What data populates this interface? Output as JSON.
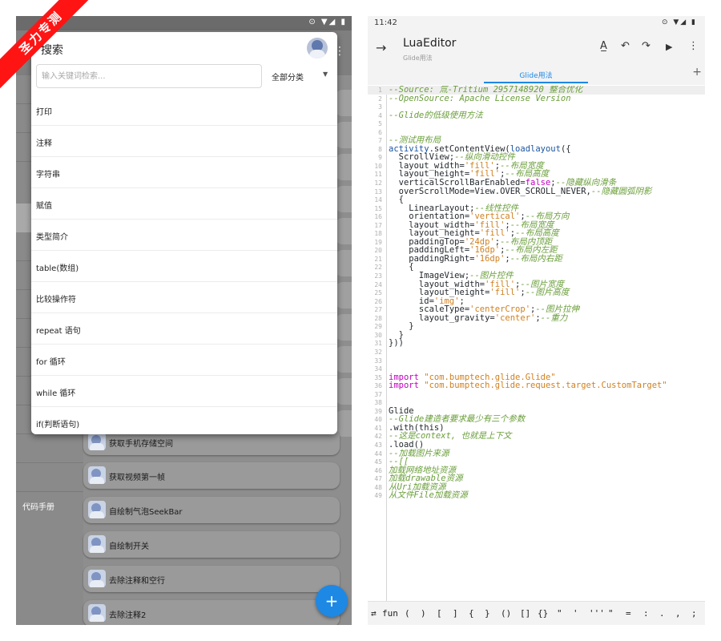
{
  "left": {
    "watermark": "圣力专测",
    "dialog": {
      "title": "搜索",
      "search_placeholder": "输入关键词检索...",
      "filter_label": "全部分类",
      "items": [
        "打印",
        "注释",
        "字符串",
        "赋值",
        "类型简介",
        "table(数组)",
        "比较操作符",
        "repeat 语句",
        "for 循环",
        "while 循环",
        "if(判断语句)"
      ]
    },
    "sidebar_label": "代码手册",
    "cards": [
      "获取手机存储空间",
      "获取视频第一帧",
      "自绘制气泡SeekBar",
      "自绘制开关",
      "去除注释和空行",
      "去除注释2"
    ]
  },
  "right": {
    "status_time": "11:42",
    "title": "LuaEditor",
    "subtitle": "Glide用法",
    "tab": "Glide用法",
    "code_lines": [
      {
        "n": "1",
        "t": "--Source: 氚-Tritium 2957148920 整合优化",
        "k": "com"
      },
      {
        "n": "2",
        "t": "--OpenSource: Apache License Version",
        "k": "com"
      },
      {
        "n": "3",
        "t": "",
        "k": "plain"
      },
      {
        "n": "4",
        "t": "--Glide的低级使用方法",
        "k": "com"
      },
      {
        "n": "5",
        "t": "",
        "k": "plain"
      },
      {
        "n": "6",
        "t": "",
        "k": "plain"
      },
      {
        "n": "7",
        "t": "--测试用布局",
        "k": "com"
      },
      {
        "n": "8",
        "t": "activity.setContentView(loadlayout({",
        "k": "plain"
      },
      {
        "n": "9",
        "t": "  ScrollView;--纵向滑动控件",
        "k": "plain"
      },
      {
        "n": "10",
        "t": "  layout_width='fill';--布局宽度",
        "k": "plain"
      },
      {
        "n": "11",
        "t": "  layout_height='fill';--布局高度",
        "k": "plain"
      },
      {
        "n": "12",
        "t": "  verticalScrollBarEnabled=false;--隐藏纵向滑条",
        "k": "plain"
      },
      {
        "n": "13",
        "t": "  overScrollMode=View.OVER_SCROLL_NEVER,--隐藏圆弧阴影",
        "k": "plain"
      },
      {
        "n": "14",
        "t": "  {",
        "k": "plain"
      },
      {
        "n": "15",
        "t": "    LinearLayout;--线性控件",
        "k": "plain"
      },
      {
        "n": "16",
        "t": "    orientation='vertical';--布局方向",
        "k": "plain"
      },
      {
        "n": "17",
        "t": "    layout_width='fill';--布局宽度",
        "k": "plain"
      },
      {
        "n": "18",
        "t": "    layout_height='fill';--布局高度",
        "k": "plain"
      },
      {
        "n": "19",
        "t": "    paddingTop='24dp';--布局内顶距",
        "k": "plain"
      },
      {
        "n": "20",
        "t": "    paddingLeft='16dp';--布局内左距",
        "k": "plain"
      },
      {
        "n": "21",
        "t": "    paddingRight='16dp';--布局内右距",
        "k": "plain"
      },
      {
        "n": "22",
        "t": "    {",
        "k": "plain"
      },
      {
        "n": "23",
        "t": "      ImageView;--图片控件",
        "k": "plain"
      },
      {
        "n": "24",
        "t": "      layout_width='fill';--图片宽度",
        "k": "plain"
      },
      {
        "n": "25",
        "t": "      layout_height='fill';--图片高度",
        "k": "plain"
      },
      {
        "n": "26",
        "t": "      id='img';",
        "k": "plain"
      },
      {
        "n": "27",
        "t": "      scaleType='centerCrop';--图片拉伸",
        "k": "plain"
      },
      {
        "n": "28",
        "t": "      layout_gravity='center';--重力",
        "k": "plain"
      },
      {
        "n": "29",
        "t": "    }",
        "k": "plain"
      },
      {
        "n": "30",
        "t": "  }",
        "k": "plain"
      },
      {
        "n": "31",
        "t": "}))",
        "k": "plain"
      },
      {
        "n": "32",
        "t": "",
        "k": "plain"
      },
      {
        "n": "33",
        "t": "",
        "k": "plain"
      },
      {
        "n": "34",
        "t": "",
        "k": "plain"
      },
      {
        "n": "35",
        "t": "import \"com.bumptech.glide.Glide\"",
        "k": "plain"
      },
      {
        "n": "36",
        "t": "import \"com.bumptech.glide.request.target.CustomTarget\"",
        "k": "plain"
      },
      {
        "n": "37",
        "t": "",
        "k": "plain"
      },
      {
        "n": "38",
        "t": "",
        "k": "plain"
      },
      {
        "n": "39",
        "t": "Glide",
        "k": "plain"
      },
      {
        "n": "40",
        "t": "--Glide建造者要求最少有三个参数",
        "k": "com"
      },
      {
        "n": "41",
        "t": ".with(this)",
        "k": "plain"
      },
      {
        "n": "42",
        "t": "--这是context, 也就是上下文",
        "k": "com"
      },
      {
        "n": "43",
        "t": ".load()",
        "k": "plain"
      },
      {
        "n": "44",
        "t": "--加载图片来源",
        "k": "com"
      },
      {
        "n": "45",
        "t": "--[[",
        "k": "com"
      },
      {
        "n": "46",
        "t": "加载网络地址资源",
        "k": "com"
      },
      {
        "n": "47",
        "t": "加载drawable资源",
        "k": "com"
      },
      {
        "n": "48",
        "t": "从Uri加载资源",
        "k": "com"
      },
      {
        "n": "49",
        "t": "从文件File加载资源",
        "k": "com"
      }
    ],
    "symbols": [
      "fun",
      "(",
      ")",
      "[",
      "]",
      "{",
      "}",
      "()",
      "[]",
      "{}",
      "\"",
      "'",
      "'''",
      "\"",
      "=",
      ":",
      ".",
      ",",
      ";"
    ]
  },
  "colors": {
    "accent": "#1e88e5",
    "watermark": "#ff1414",
    "comment": "#6a9e3a",
    "string": "#d08020",
    "keyword": "#c000c0"
  }
}
